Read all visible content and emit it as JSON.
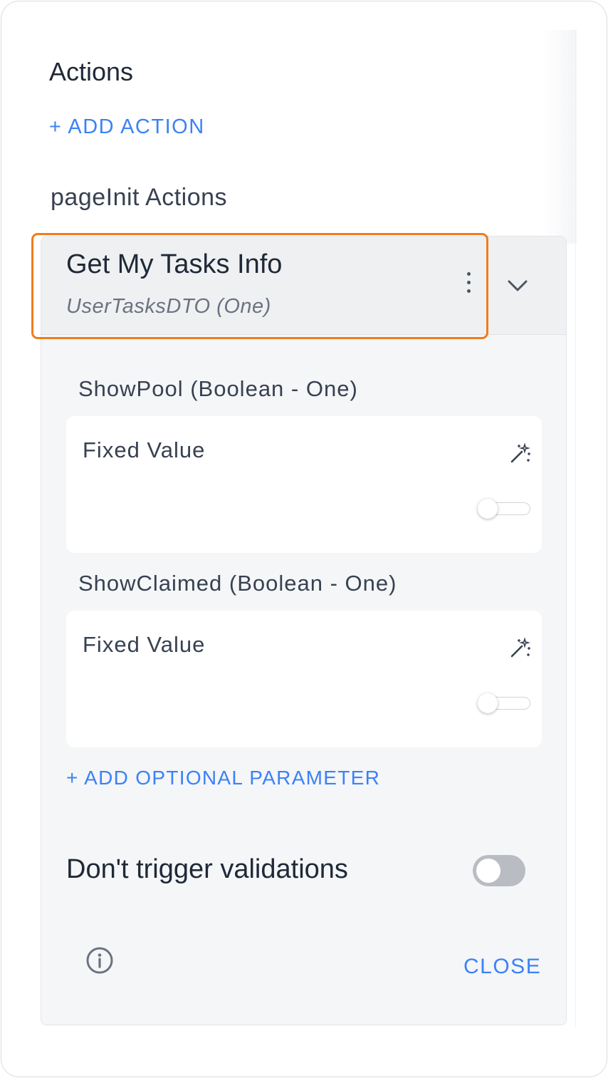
{
  "actions": {
    "heading": "Actions",
    "add_action_label": "+ ADD ACTION",
    "section_label": "pageInit Actions"
  },
  "action_item": {
    "title": "Get My Tasks Info",
    "subtitle": "UserTasksDTO (One)",
    "menu_icon": "kebab-vertical-icon",
    "expand_icon": "chevron-down-icon",
    "expanded": true
  },
  "parameters": [
    {
      "label": "ShowPool (Boolean - One)",
      "mode": "Fixed Value",
      "icon": "magic-wand-icon",
      "value": false
    },
    {
      "label": "ShowClaimed (Boolean - One)",
      "mode": "Fixed Value",
      "icon": "magic-wand-icon",
      "value": false
    }
  ],
  "add_param_label": "+ ADD OPTIONAL PARAMETER",
  "validation": {
    "label": "Don't trigger validations",
    "enabled": false
  },
  "footer": {
    "info_icon": "info-circle-icon",
    "close_label": "CLOSE"
  },
  "colors": {
    "accent": "#3b82f6",
    "highlight": "#f07c1d",
    "toggle_off": "#b9bcc2"
  }
}
